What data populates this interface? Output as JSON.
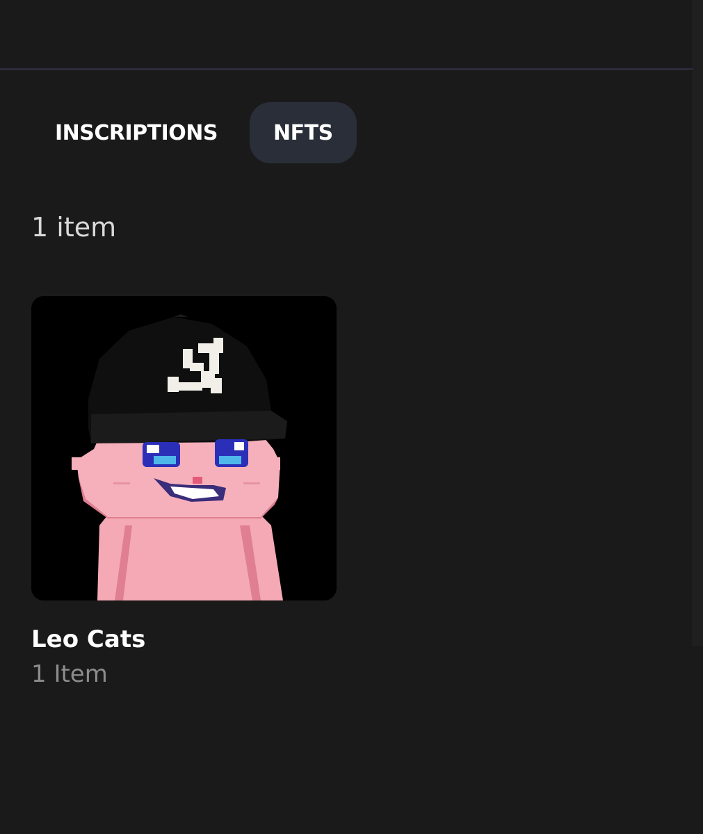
{
  "tabs": [
    {
      "label": "INSCRIPTIONS",
      "active": false
    },
    {
      "label": "NFTS",
      "active": true
    }
  ],
  "collection_count": "1 item",
  "collections": [
    {
      "name": "Leo Cats",
      "count": "1 Item",
      "image_icon": "pixel-cat-image"
    }
  ],
  "colors": {
    "background": "#1a1a1b",
    "active_tab": "#2a2e38",
    "muted_text": "#8c8c8c"
  }
}
